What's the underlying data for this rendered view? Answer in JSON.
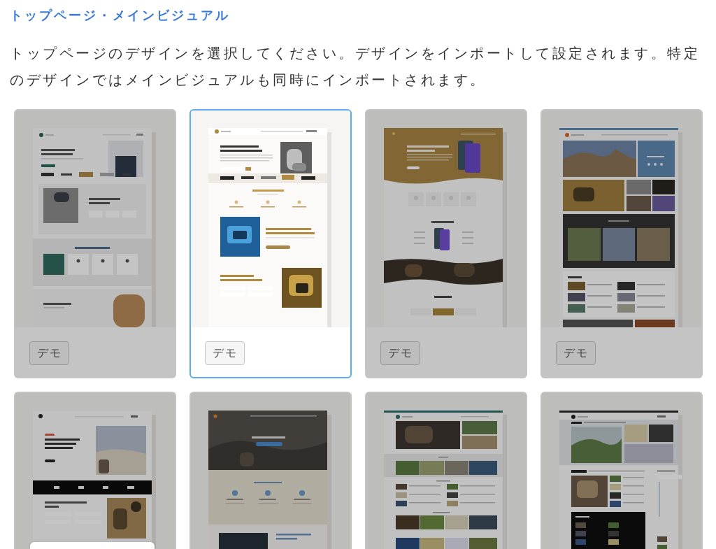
{
  "section": {
    "title": "トップページ・メインビジュアル",
    "description": "トップページのデザインを選択してください。デザインをインポートして設定されます。特定のデザインではメインビジュアルも同時にインポートされます。"
  },
  "designs": [
    {
      "selected": false,
      "button": "デモ"
    },
    {
      "selected": true,
      "button": "デモ"
    },
    {
      "selected": false,
      "button": "デモ"
    },
    {
      "selected": false,
      "button": "デモ"
    },
    {
      "selected": false
    },
    {
      "selected": false
    },
    {
      "selected": false
    },
    {
      "selected": false
    }
  ]
}
